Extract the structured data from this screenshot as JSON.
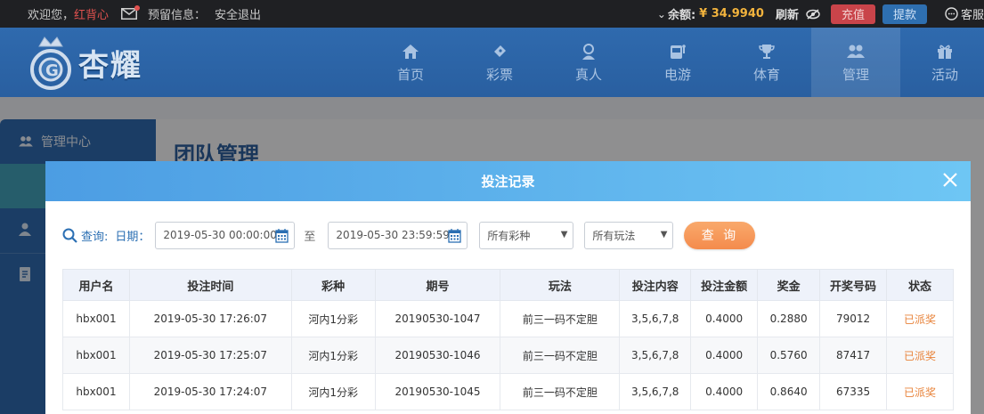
{
  "topbar": {
    "welcome": "欢迎您，",
    "username": "红背心",
    "warning_label": "预留信息：",
    "logout": "安全退出",
    "balance_label": "余额:",
    "balance_value": "¥ 34.9940",
    "refresh": "刷新",
    "recharge": "充值",
    "withdraw": "提款",
    "cs": "客服"
  },
  "header": {
    "logo_text": "杏耀",
    "nav": [
      {
        "label": "首页",
        "icon": "home-icon"
      },
      {
        "label": "彩票",
        "icon": "ticket-icon"
      },
      {
        "label": "真人",
        "icon": "user-live-icon"
      },
      {
        "label": "电游",
        "icon": "slot-icon"
      },
      {
        "label": "体育",
        "icon": "trophy-icon"
      },
      {
        "label": "管理",
        "icon": "users-icon"
      },
      {
        "label": "活动",
        "icon": "gift-icon"
      }
    ]
  },
  "sidebar": {
    "head": "管理中心"
  },
  "main": {
    "title": "团队管理"
  },
  "modal": {
    "title": "投注记录",
    "query_label": "查询:",
    "date_label": "日期：",
    "date_start": "2019-05-30 00:00:00",
    "to_label": "至",
    "date_end": "2019-05-30 23:59:59",
    "lottery_select": "所有彩种",
    "play_select": "所有玩法",
    "query_button": "查 询",
    "columns": [
      "用户名",
      "投注时间",
      "彩种",
      "期号",
      "玩法",
      "投注内容",
      "投注金额",
      "奖金",
      "开奖号码",
      "状态"
    ],
    "rows": [
      [
        "hbx001",
        "2019-05-30 17:26:07",
        "河内1分彩",
        "20190530-1047",
        "前三一码不定胆",
        "3,5,6,7,8",
        "0.4000",
        "0.2880",
        "79012",
        "已派奖"
      ],
      [
        "hbx001",
        "2019-05-30 17:25:07",
        "河内1分彩",
        "20190530-1046",
        "前三一码不定胆",
        "3,5,6,7,8",
        "0.4000",
        "0.5760",
        "87417",
        "已派奖"
      ],
      [
        "hbx001",
        "2019-05-30 17:24:07",
        "河内1分彩",
        "20190530-1045",
        "前三一码不定胆",
        "3,5,6,7,8",
        "0.4000",
        "0.8640",
        "67335",
        "已派奖"
      ]
    ]
  },
  "colors": {
    "accent": "#2f6aae",
    "status": "#e8833a",
    "query_button": "#f48b4c"
  }
}
